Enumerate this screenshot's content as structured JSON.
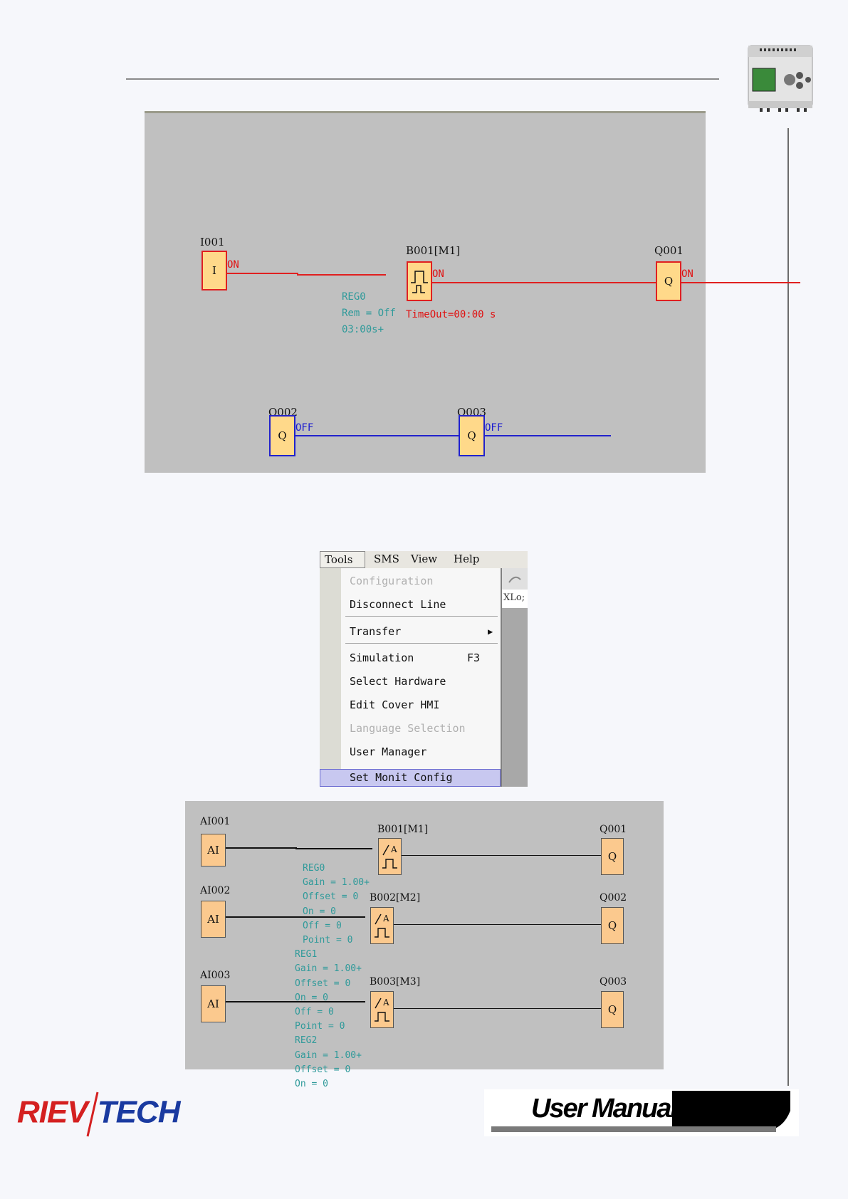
{
  "diagram1": {
    "i001": {
      "name": "I001",
      "symbol": "I",
      "state": "ON"
    },
    "b001": {
      "name": "B001[M1]",
      "state": "ON",
      "timeout": "TimeOut=00:00 s",
      "params": [
        "REG0",
        "Rem = Off",
        "03:00s+"
      ]
    },
    "q001": {
      "name": "Q001",
      "symbol": "Q",
      "state": "ON"
    },
    "q002": {
      "name": "Q002",
      "symbol": "Q",
      "state": "OFF"
    },
    "q003": {
      "name": "Q003",
      "symbol": "Q",
      "state": "OFF"
    }
  },
  "menu": {
    "bar": [
      "Tools",
      "SMS",
      "View",
      "Help"
    ],
    "items": [
      "Configuration",
      "Disconnect Line",
      "Transfer",
      "Simulation",
      "Select Hardware",
      "Edit Cover HMI",
      "Language Selection",
      "User Manager",
      "Set Monit Config"
    ],
    "simulation_shortcut": "F3",
    "side_text": "XLo;"
  },
  "diagram2": {
    "rows": [
      {
        "input": "AI001",
        "in_symbol": "AI",
        "block": "B001[M1]",
        "output": "Q001",
        "out_symbol": "Q"
      },
      {
        "input": "AI002",
        "in_symbol": "AI",
        "block": "B002[M2]",
        "output": "Q002",
        "out_symbol": "Q"
      },
      {
        "input": "AI003",
        "in_symbol": "AI",
        "block": "B003[M3]",
        "output": "Q003",
        "out_symbol": "Q"
      }
    ],
    "params": [
      "REG0",
      "Gain = 1.00+",
      "Offset = 0",
      "On = 0",
      "Off = 0",
      "Point = 0",
      "REG1",
      "Gain = 1.00+",
      "Offset = 0",
      "On = 0",
      "Off = 0",
      "Point = 0",
      "REG2",
      "Gain = 1.00+",
      "Offset = 0",
      "On = 0"
    ]
  },
  "footer": {
    "logo_left": "RIEV",
    "logo_right": "TECH",
    "banner": "User Manual"
  }
}
